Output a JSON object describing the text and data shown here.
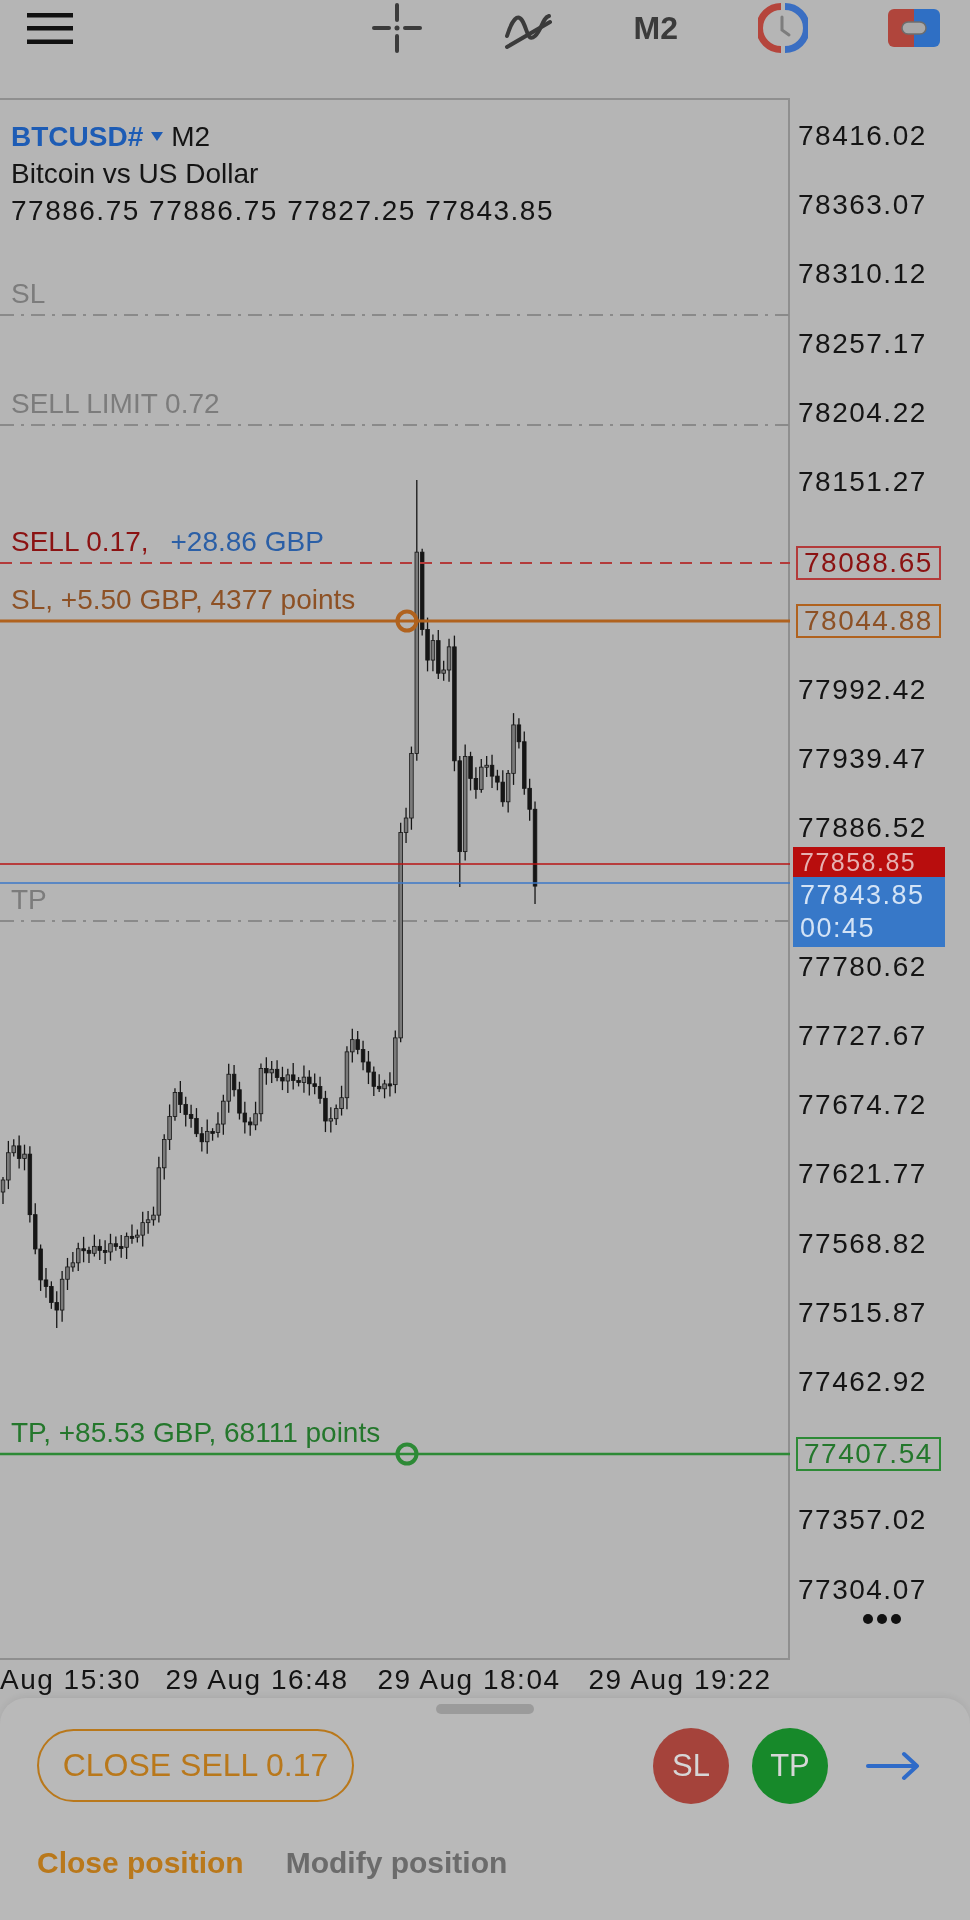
{
  "toolbar": {
    "timeframe": "M2"
  },
  "chart": {
    "symbol": "BTCUSD#",
    "timeframe": "M2",
    "description": "Bitcoin vs US Dollar",
    "ohlc": "77886.75 77886.75 77827.25 77843.85",
    "levels": [
      {
        "kind": "pending",
        "label": "SL"
      },
      {
        "kind": "pending",
        "label": "SELL LIMIT 0.72"
      },
      {
        "kind": "position",
        "label": "SELL 0.17,",
        "profit": "+28.86 GBP",
        "price": "78088.65"
      },
      {
        "kind": "stop-loss",
        "label": "SL, +5.50 GBP, 4377 points",
        "price": "78044.88"
      },
      {
        "kind": "ask",
        "price": "77858.85"
      },
      {
        "kind": "pending",
        "label": "TP"
      },
      {
        "kind": "bid",
        "price": "77843.85",
        "countdown": "00:45"
      },
      {
        "kind": "take-profit",
        "label": "TP, +85.53 GBP, 68111 points",
        "price": "77407.54"
      }
    ],
    "price_axis": [
      "78416.02",
      "78363.07",
      "78310.12",
      "78257.17",
      "78204.22",
      "78151.27",
      "77992.42",
      "77939.47",
      "77886.52",
      "77780.62",
      "77727.67",
      "77674.72",
      "77621.77",
      "77568.82",
      "77515.87",
      "77462.92",
      "77357.02",
      "77304.07"
    ],
    "time_axis": [
      "Aug 15:30",
      "29 Aug 16:48",
      "29 Aug 18:04",
      "29 Aug 19:22"
    ]
  },
  "bottom_sheet": {
    "close_button": "CLOSE SELL 0.17",
    "sl_button": "SL",
    "tp_button": "TP",
    "tabs": [
      {
        "label": "Close position",
        "selected": true
      },
      {
        "label": "Modify position",
        "selected": false
      }
    ]
  }
}
